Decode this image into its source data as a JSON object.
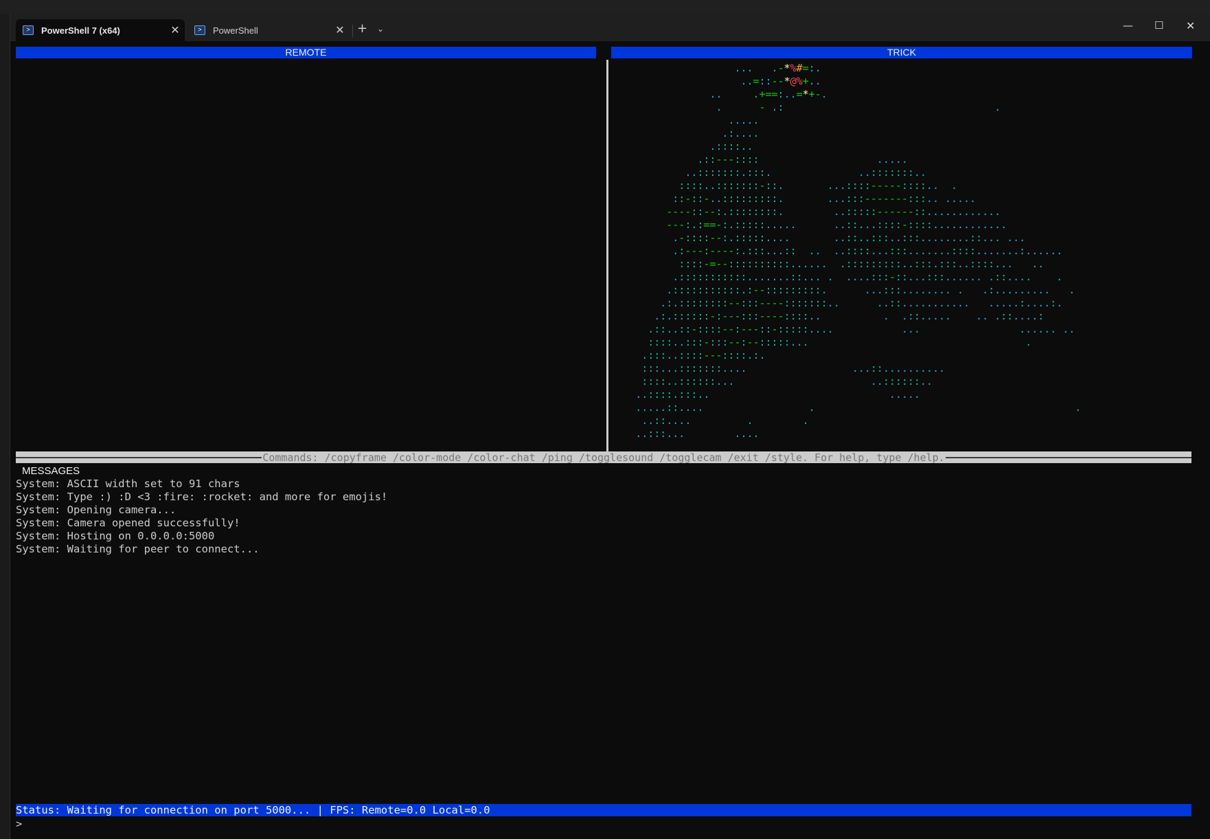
{
  "window": {
    "tabs": [
      {
        "label": "PowerShell 7 (x64)",
        "active": true
      },
      {
        "label": "PowerShell",
        "active": false
      }
    ],
    "new_tab_glyph": "+",
    "dropdown_glyph": "⌄",
    "minimize_glyph": "—",
    "maximize_glyph": "☐",
    "close_glyph": "✕",
    "tab_close_glyph": "✕"
  },
  "panes": {
    "remote_title": "REMOTE",
    "local_title": "TRICK"
  },
  "ascii_frame": [
    "                    ...   .-*%#=:.",
    "                     ..=::--*@%+..",
    "                ..     .+==:..=*+-.",
    "                 .      - .:                                  .",
    "                   .....",
    "                  .:....",
    "                .::::..",
    "              .::---::::                   .....",
    "            ..:::::::.:::.              ..:::::::..",
    "           ::::..:::::::-::.       ...::::-----::::..  .",
    "          ::-::-..:::::::::.       ...:::-------:::.. .....",
    "         ----::--:.::::::::.        ..:::::------::............",
    "         ---:.:==-:.:::::.....      ..::...::::-::::............",
    "          .-::::--:.:::::....       ..::..:::..:::........::... ...",
    "          .:---:----:.:::...::  ..  ..::::...:::.......::::.......:......",
    "           ::::-=--::::::::::......  .:::::::::..:::.:::..::::...   ..",
    "          .:::::::::::.......::... .  ....:::-::...:::...... .::....    .",
    "         .:::::::::::.:--:::::::::.      ...:::........ .   .:.........   .",
    "        .:.::::::::--:::----:::::::..      ..::...........   .....:....:.",
    "       .:.::::::-:---:::----::::..          .  .::.....    .. .::....:",
    "      .::..::-::::--:---::-:::::....           ...                ...... ..",
    "      ::::..:::-:::--:--:::::...                                   .",
    "     .:::..::::---::::.:.",
    "     :::...:::::::....                 ...::..........",
    "     ::::..::::::...                      ..::::::..",
    "    ..::::.:::..                             .....",
    "    .....::....                 .                                          .",
    "     ..::....         .        .",
    "    ..:::...        ...."
  ],
  "command_bar": "Commands: /copyframe /color-mode /color-chat /ping /togglesound /togglecam /exit /style. For help, type /help.",
  "messages": {
    "title": "MESSAGES",
    "lines": [
      "System: ASCII width set to 91 chars",
      "System: Type :) :D <3 :fire: :rocket: and more for emojis!",
      "System: Opening camera...",
      "System: Camera opened successfully!",
      "System: Hosting on 0.0.0.0:5000",
      "System: Waiting for peer to connect..."
    ]
  },
  "status": "Status: Waiting for connection on port 5000... | FPS: Remote=0.0 Local=0.0",
  "prompt": ">",
  "colors": {
    "accent_blue": "#0037da",
    "terminal_bg": "#0c0c0c",
    "ascii_cyan": "#2aa6d6",
    "ascii_teal": "#19b99a",
    "ascii_green": "#16c60c",
    "ascii_red": "#e74856"
  }
}
